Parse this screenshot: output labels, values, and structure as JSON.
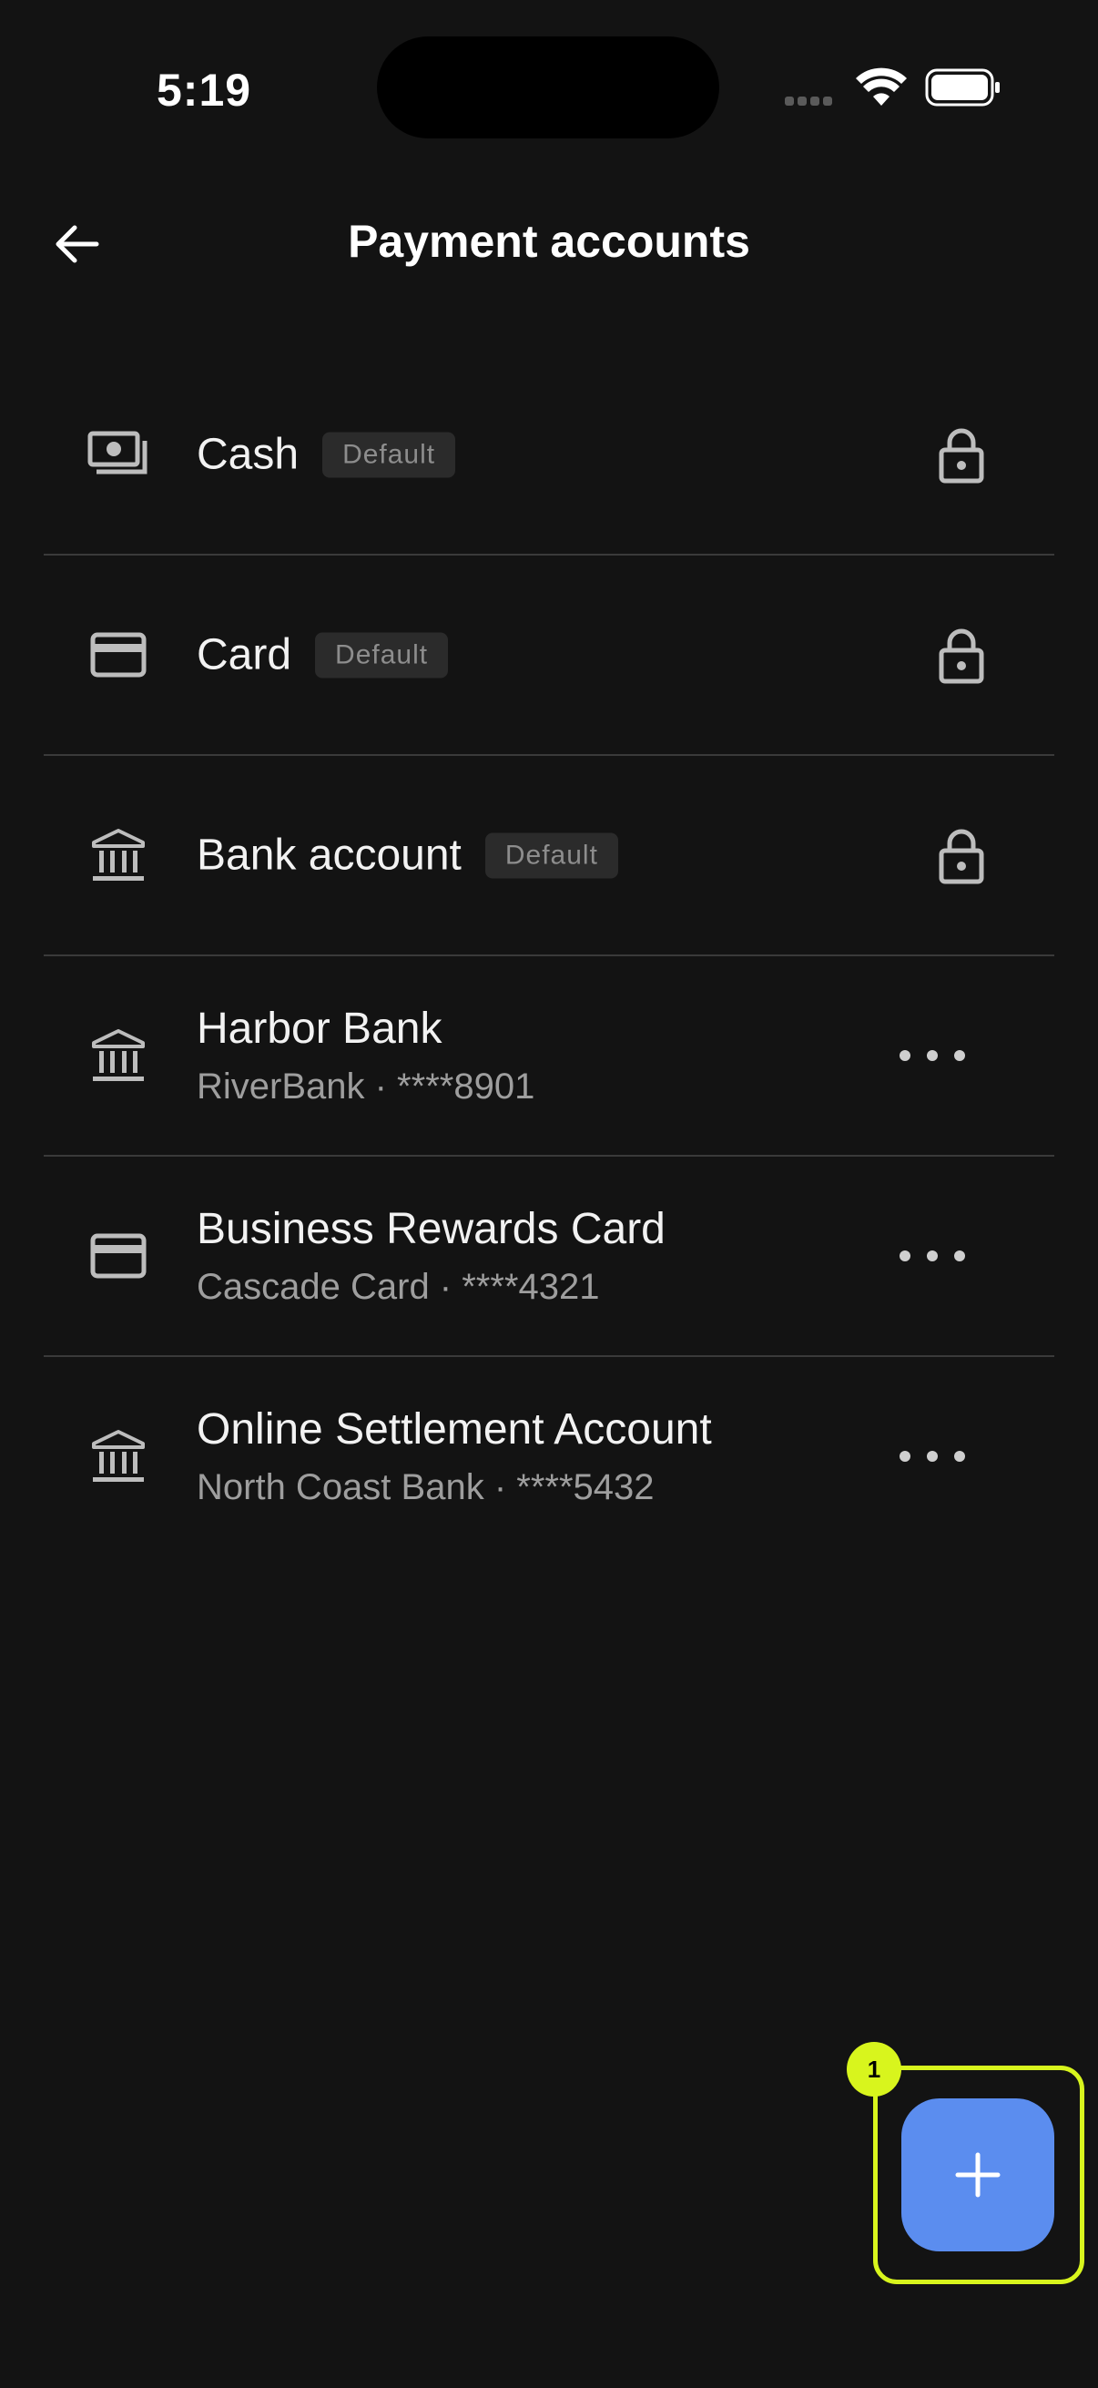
{
  "status_bar": {
    "time": "5:19"
  },
  "header": {
    "title": "Payment accounts"
  },
  "accounts": [
    {
      "icon": "cash-icon",
      "name": "Cash",
      "badge": "Default",
      "locked": true
    },
    {
      "icon": "card-icon",
      "name": "Card",
      "badge": "Default",
      "locked": true
    },
    {
      "icon": "bank-icon",
      "name": "Bank account",
      "badge": "Default",
      "locked": true
    },
    {
      "icon": "bank-icon",
      "name": "Harbor Bank",
      "detail": "RiverBank · ****8901"
    },
    {
      "icon": "card-icon",
      "name": "Business Rewards Card",
      "detail": "Cascade Card · ****4321"
    },
    {
      "icon": "bank-icon",
      "name": "Online Settlement Account",
      "detail": "North Coast Bank · ****5432"
    }
  ],
  "fab": {
    "marker": "1",
    "highlight_color": "#d8f51d",
    "color": "#5b8def"
  }
}
